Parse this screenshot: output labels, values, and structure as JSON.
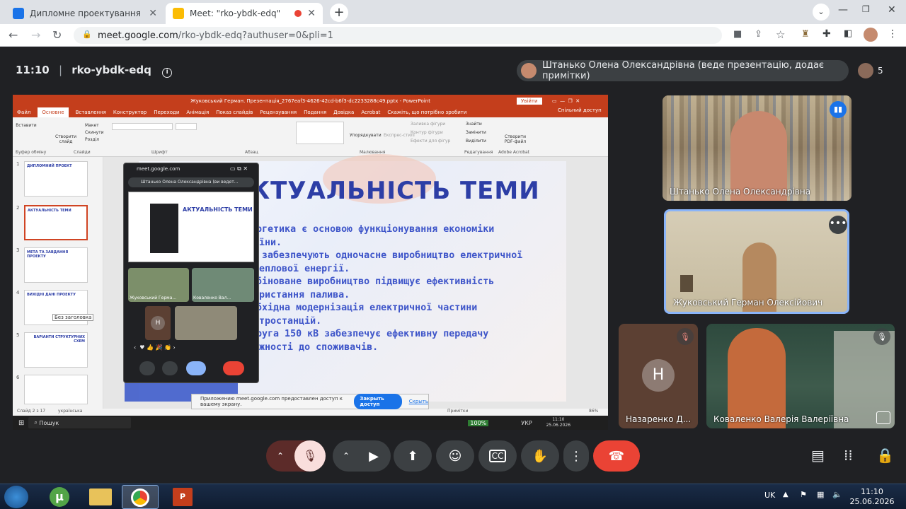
{
  "browser": {
    "tabs": [
      {
        "title": "Дипломне проектування ЕТ-22-",
        "fav_color": "#1a73e8"
      },
      {
        "title": "Meet: \"rko-ybdk-edq\"",
        "fav_color": "#fbbc04"
      }
    ],
    "new_tab": "+",
    "url_host": "meet.google.com",
    "url_path": "/rko-ybdk-edq?authuser=0&pli=1"
  },
  "meet": {
    "time": "11:10",
    "separator": "|",
    "code": "rko-ybdk-edq",
    "presenter": "Штанько Олена Олександрівна (веде презентацію, додає примітки)",
    "participants_count": "5",
    "tiles": [
      {
        "name": "Штанько Олена Олександрівна"
      },
      {
        "name": "Жуковський Герман Олексійович"
      },
      {
        "name": "Назаренко Д...",
        "initial": "Н"
      },
      {
        "name": "Коваленко Валерія Валеріївна"
      }
    ]
  },
  "ppt": {
    "title": "Жуковський Герман. Презентація_2767eaf3-4626-42cd-b6f3-dc2233288c49.pptx - PowerPoint",
    "signin": "Увійти",
    "menu": [
      "Файл",
      "Основне",
      "Вставлення",
      "Конструктор",
      "Переходи",
      "Анімація",
      "Показ слайдів",
      "Рецензування",
      "Подання",
      "Довідка",
      "Acrobat",
      "Скажіть, що потрібно зробити"
    ],
    "share_label": "Спільний доступ",
    "ribbon_groups": [
      "Буфер обміну",
      "Слайди",
      "Шрифт",
      "Абзац",
      "Малювання",
      "Редагування",
      "Adobe Acrobat"
    ],
    "ribbon_items": [
      "Вставити",
      "Створити слайд",
      "Макет",
      "Скинути",
      "Розділ",
      "Упорядкувати",
      "Експрес-стилі",
      "Заливка фігури",
      "Контур фігури",
      "Ефекти для фігур",
      "Знайти",
      "Замінити",
      "Виділити",
      "Створити PDF-файл"
    ],
    "thumbs": [
      {
        "n": "1",
        "text": "ДИПЛОМНИЙ ПРОЕКТ"
      },
      {
        "n": "2",
        "text": "АКТУАЛЬНІСТЬ ТЕМИ"
      },
      {
        "n": "3",
        "text": "МЕТА ТА ЗАВДАННЯ ПРОЕКТУ"
      },
      {
        "n": "4",
        "text": "ВИХІДНІ ДАНІ ПРОЕКТУ"
      },
      {
        "n": "5",
        "text": "ВАРІАНТИ СТРУКТУРНИХ СХЕМ"
      },
      {
        "n": "6",
        "text": ""
      }
    ],
    "tooltip": "Без заголовка",
    "slide_title": "АКТУАЛЬНІСТЬ ТЕМИ",
    "bullets": [
      "Енергетика є основою функціонування економіки України.",
      "ТЕЦ забезпечують одночасне виробництво електричної та теплової енергії.",
      "Комбіноване виробництво підвищує ефективність використання палива.",
      "Необхідна модернізація електричної частини електростанцій.",
      "Напруга 150 кВ забезпечує ефективну передачу потужності до споживачів."
    ],
    "status_left": "Слайд 2 з 17",
    "status_lang": "українська",
    "notes": "Примітки",
    "zoom": "86%",
    "share_msg": "Приложению meet.google.com предоставлен доступ к вашему экрану.",
    "share_btn": "Закрыть доступ",
    "share_hide": "Скрыть",
    "overlay": {
      "host": "meet.google.com",
      "presenter": "Штанько Олена Олександрівна (ви ведет...",
      "mini_title": "АКТУАЛЬНІСТЬ ТЕМИ",
      "n1": "Жуковський Герма...",
      "n2": "Коваленко Вал...",
      "initial": "Н"
    },
    "win_search": "Пошук",
    "win_battery": "100%",
    "win_lang": "УКР",
    "win_time": "11:10",
    "win_date": "25.06.2026"
  },
  "taskbar": {
    "lang": "UK",
    "time": "11:10",
    "date": "25.06.2026"
  },
  "colors": {
    "ppt_red": "#c43e1c",
    "slide_blue": "#2d3ea6",
    "end_call": "#ea4335",
    "mic_off": "#5c2b29"
  }
}
